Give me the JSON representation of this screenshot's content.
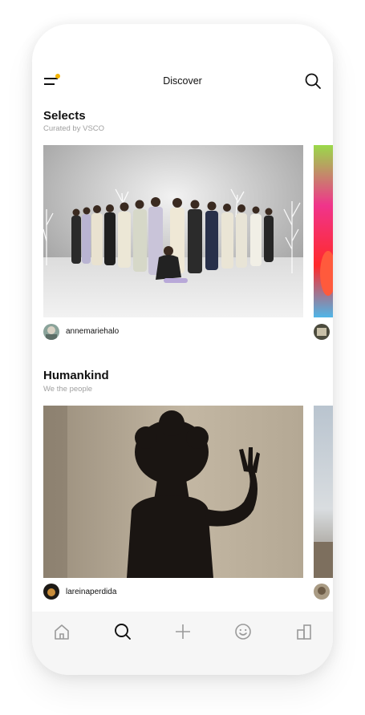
{
  "header": {
    "title": "Discover"
  },
  "icons": {
    "menu": "menu-icon",
    "notification_dot_color": "#f4b400",
    "search": "search-icon"
  },
  "sections": [
    {
      "title": "Selects",
      "subtitle": "Curated by VSCO",
      "username": "annemariehalo"
    },
    {
      "title": "Humankind",
      "subtitle": "We the people",
      "username": "lareinaperdida"
    }
  ],
  "tabbar": {
    "tabs": [
      "home-icon",
      "search-icon",
      "add-icon",
      "smiley-icon",
      "studio-icon"
    ],
    "active": "search-icon"
  }
}
